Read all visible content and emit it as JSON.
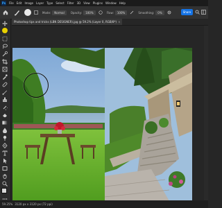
{
  "app": {
    "name": "Photoshop",
    "logo_text": "Ps"
  },
  "menu": [
    "File",
    "Edit",
    "Image",
    "Layer",
    "Type",
    "Select",
    "Filter",
    "3D",
    "View",
    "Plugins",
    "Window",
    "Help"
  ],
  "options": {
    "mode_label": "Mode:",
    "mode_value": "Normal",
    "opacity_label": "Opacity:",
    "opacity_value": "100%",
    "flow_label": "Flow:",
    "flow_value": "100%",
    "smoothing_label": "Smoothing:",
    "smoothing_value": "0%",
    "share_label": "Share"
  },
  "document": {
    "tab_title": "Photoshop tips and tricks (LBN DESIGNER).jpg @ 59.2% (Layer 0, RGB/8*)",
    "close_glyph": "×"
  },
  "status": {
    "zoom": "59.25%",
    "doc_info": "3120 px x 3120 px (72 ppi)"
  },
  "colors": {
    "accent": "#1473e6",
    "foreground_swatch": "#d9d9d9",
    "background_swatch": "#c4161c",
    "tool_highlight": "#e8d000"
  },
  "tools": [
    "move-icon",
    "artboard-icon",
    "marquee-icon",
    "lasso-icon",
    "quick-select-icon",
    "crop-icon",
    "frame-icon",
    "eyedropper-icon",
    "healing-icon",
    "brush-icon",
    "clone-stamp-icon",
    "history-brush-icon",
    "eraser-icon",
    "gradient-icon",
    "blur-icon",
    "dodge-icon",
    "pen-icon",
    "type-icon",
    "path-select-icon",
    "rectangle-icon",
    "hand-icon",
    "zoom-icon",
    "more-tools-icon"
  ]
}
